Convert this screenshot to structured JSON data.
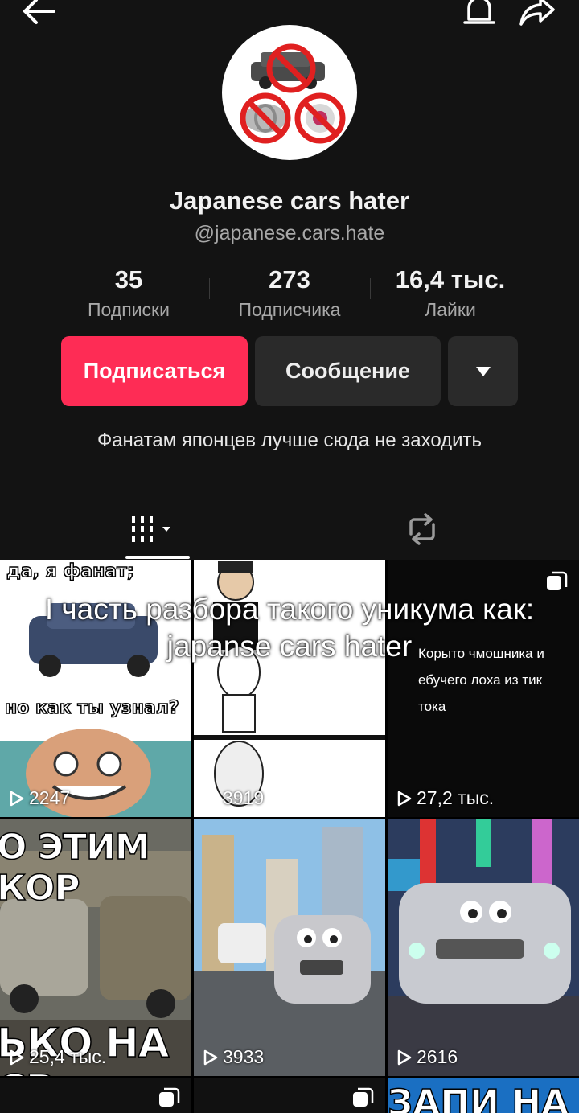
{
  "profile": {
    "display_name": "Japanese cars hater",
    "handle": "@japanese.cars.hate",
    "bio": "Фанатам японцев лучше сюда не заходить"
  },
  "stats": [
    {
      "value": "35",
      "label": "Подписки"
    },
    {
      "value": "273",
      "label": "Подписчика"
    },
    {
      "value": "16,4 тыс.",
      "label": "Лайки"
    }
  ],
  "actions": {
    "follow_label": "Подписаться",
    "message_label": "Сообщение"
  },
  "tabs": {
    "videos_icon": "grid-icon",
    "reposts_icon": "repost-icon"
  },
  "overlay_caption": "I часть разбора такого уникума как: japanse cars hater",
  "videos": [
    {
      "views": "2247",
      "top_text": "да, я фанат;",
      "bottom_text": "но как ты узнал?"
    },
    {
      "views": "3919"
    },
    {
      "views": "27,2 тыс.",
      "text": "Корыто чмошника и ебучего лоха из тик тока"
    },
    {
      "views": "25,4 тыс.",
      "top_text": "О ЭТИМ КОР",
      "bottom_text": "ЬКО НА СВ"
    },
    {
      "views": "3933"
    },
    {
      "views": "2616"
    },
    {},
    {},
    {
      "top_text": "ЗАПИ НА"
    }
  ],
  "colors": {
    "background": "#131313",
    "accent": "#fe2c55",
    "button_secondary": "#2a2a2a",
    "muted_text": "#a8a8a8"
  }
}
